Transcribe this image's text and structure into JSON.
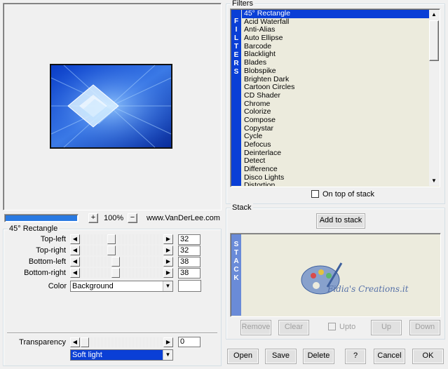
{
  "preview": {
    "zoom_plus": "+",
    "zoom_value": "100%",
    "zoom_minus": "−",
    "website": "www.VanDerLee.com"
  },
  "params": {
    "title": "45° Rectangle",
    "rows": [
      {
        "label": "Top-left",
        "value": "32",
        "fraction": 0.36
      },
      {
        "label": "Top-right",
        "value": "32",
        "fraction": 0.36
      },
      {
        "label": "Bottom-left",
        "value": "38",
        "fraction": 0.42
      },
      {
        "label": "Bottom-right",
        "value": "38",
        "fraction": 0.42
      }
    ],
    "color_label": "Color",
    "color_value": "Background",
    "transparency_label": "Transparency",
    "transparency_value": "0",
    "blend_value": "Soft light"
  },
  "filters": {
    "title": "Filters",
    "side_label": [
      "F",
      "I",
      "L",
      "T",
      "E",
      "R",
      "S"
    ],
    "items": [
      "45° Rectangle",
      "Acid Waterfall",
      "Anti-Alias",
      "Auto Ellipse",
      "Barcode",
      "Blacklight",
      "Blades",
      "Blobspike",
      "Brighten Dark",
      "Cartoon Circles",
      "CD Shader",
      "Chrome",
      "Colorize",
      "Compose",
      "Copystar",
      "Cycle",
      "Defocus",
      "Deinterlace",
      "Detect",
      "Difference",
      "Disco Lights",
      "Distortion"
    ],
    "selected_index": 0,
    "on_top_label": "On top of stack"
  },
  "stack": {
    "title": "Stack",
    "add_button": "Add to stack",
    "side_label": [
      "S",
      "T",
      "A",
      "C",
      "K"
    ],
    "watermark": "Fidia's Creations.it",
    "buttons": {
      "remove": "Remove",
      "clear": "Clear",
      "upto": "Upto",
      "up": "Up",
      "down": "Down"
    }
  },
  "footer": {
    "open": "Open",
    "save": "Save",
    "delete": "Delete",
    "help": "?",
    "cancel": "Cancel",
    "ok": "OK"
  },
  "colors": {
    "accent_blue": "#0a3fd6",
    "list_bg": "#ecebdd",
    "stack_side": "#6a8bd8"
  }
}
